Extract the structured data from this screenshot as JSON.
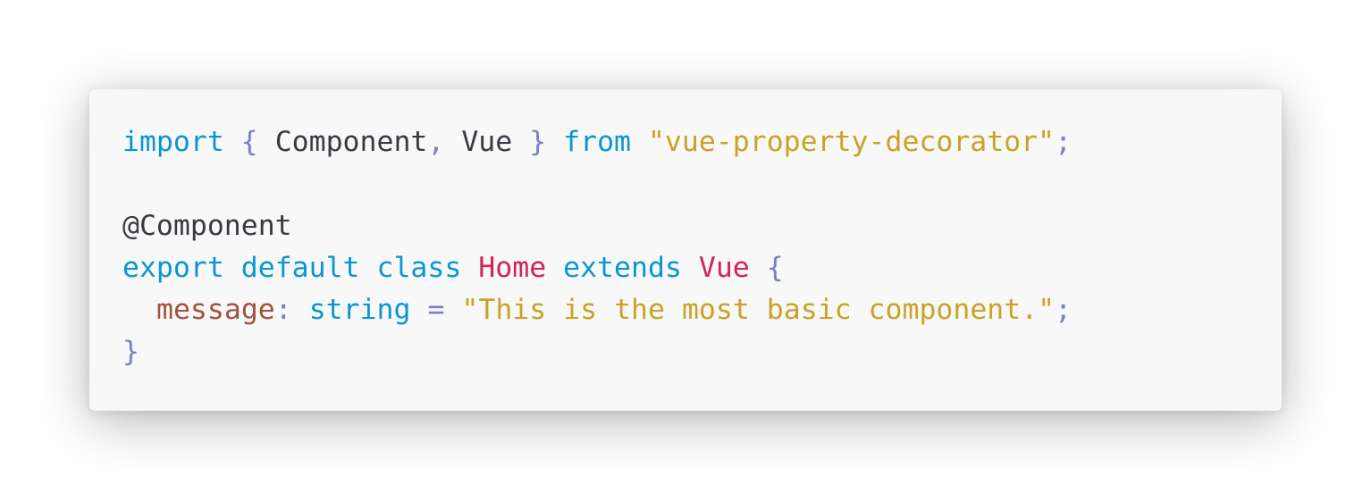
{
  "colors": {
    "keyword": "#0a96d2",
    "punctuation": "#7a7fc8",
    "plain": "#383a42",
    "string": "#c9a227",
    "class_name": "#d0245a",
    "property": "#a0523d",
    "card_background": "#f8f8f8"
  },
  "code": {
    "line1": {
      "kw_import": "import",
      "brace_open": "{",
      "ident_component": "Component",
      "comma": ",",
      "ident_vue": "Vue",
      "brace_close": "}",
      "kw_from": "from",
      "module_string": "\"vue-property-decorator\"",
      "semicolon": ";"
    },
    "line3": {
      "decorator": "@Component"
    },
    "line4": {
      "kw_export": "export",
      "kw_default": "default",
      "kw_class": "class",
      "class_name": "Home",
      "kw_extends": "extends",
      "base_class": "Vue",
      "brace_open": "{"
    },
    "line5": {
      "property": "message",
      "colon": ":",
      "type": "string",
      "equals": "=",
      "value_string": "\"This is the most basic component.\"",
      "semicolon": ";"
    },
    "line6": {
      "brace_close": "}"
    }
  }
}
